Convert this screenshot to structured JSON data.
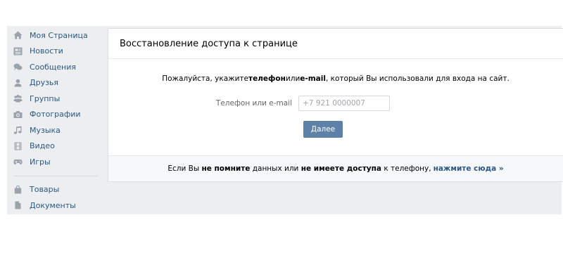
{
  "sidebar": {
    "items": [
      {
        "label": "Моя Страница",
        "icon": "home-icon"
      },
      {
        "label": "Новости",
        "icon": "news-icon"
      },
      {
        "label": "Сообщения",
        "icon": "messages-icon"
      },
      {
        "label": "Друзья",
        "icon": "friend-icon"
      },
      {
        "label": "Группы",
        "icon": "groups-icon"
      },
      {
        "label": "Фотографии",
        "icon": "camera-icon"
      },
      {
        "label": "Музыка",
        "icon": "music-note-icon"
      },
      {
        "label": "Видео",
        "icon": "film-icon"
      },
      {
        "label": "Игры",
        "icon": "gamepad-icon"
      }
    ],
    "extra_items": [
      {
        "label": "Товары",
        "icon": "shopping-bag-icon"
      },
      {
        "label": "Документы",
        "icon": "document-icon"
      }
    ]
  },
  "card": {
    "title": "Восстановление доступа к странице",
    "intro": {
      "part1": "Пожалуйста, укажите ",
      "bold1": "телефон",
      "part2": " или ",
      "bold2": "e-mail",
      "part3": ", который Вы использовали для входа на сайт."
    },
    "field_label": "Телефон или e-mail",
    "field_placeholder": "+7 921 0000007",
    "field_value": "",
    "submit_label": "Далее",
    "footer": {
      "part1": "Если Вы ",
      "bold1": "не помните",
      "part2": " данных или ",
      "bold2": "не имеете доступа",
      "part3": " к телефону,",
      "link": "нажмите сюда »"
    }
  },
  "colors": {
    "link": "#2a5885",
    "button": "#5e81a8",
    "page_background": "#edeef0",
    "icon": "#99a2ad"
  }
}
